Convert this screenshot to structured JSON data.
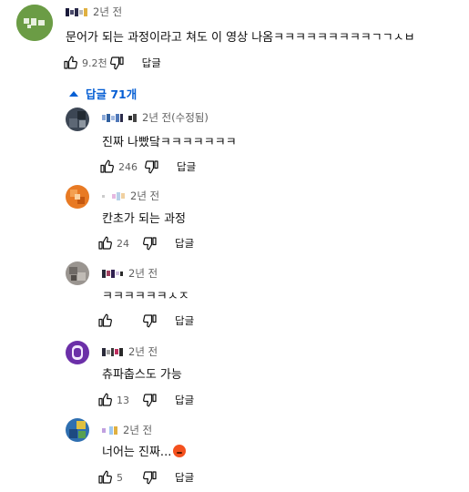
{
  "top_comment": {
    "time": "2년 전",
    "text": "문어가 되는 과정이라고 쳐도 이 영상 나옴ㅋㅋㅋㅋㅋㅋㅋㅋㅋㄱㄱㅅㅂ",
    "likes": "9.2천",
    "reply_label": "답글"
  },
  "replies_toggle": {
    "label": "답글 71개"
  },
  "replies": [
    {
      "time": "2년 전(수정됨)",
      "text": "진짜 나빴닼ㅋㅋㅋㅋㅋㅋㅋ",
      "likes": "246",
      "reply_label": "답글"
    },
    {
      "time": "2년 전",
      "text": "칸초가 되는 과정",
      "likes": "24",
      "reply_label": "답글"
    },
    {
      "time": "2년 전",
      "text": "ㅋㅋㅋㅋㅋㅋㅅㅈ",
      "likes": "",
      "reply_label": "답글"
    },
    {
      "time": "2년 전",
      "text": "츄파춥스도 가능",
      "likes": "13",
      "reply_label": "답글"
    },
    {
      "time": "2년 전",
      "text": "너어는 진짜...",
      "likes": "5",
      "reply_label": "답글"
    }
  ],
  "colors": {
    "link_blue": "#065fd4",
    "meta_gray": "#606060",
    "text": "#0f0f0f"
  }
}
